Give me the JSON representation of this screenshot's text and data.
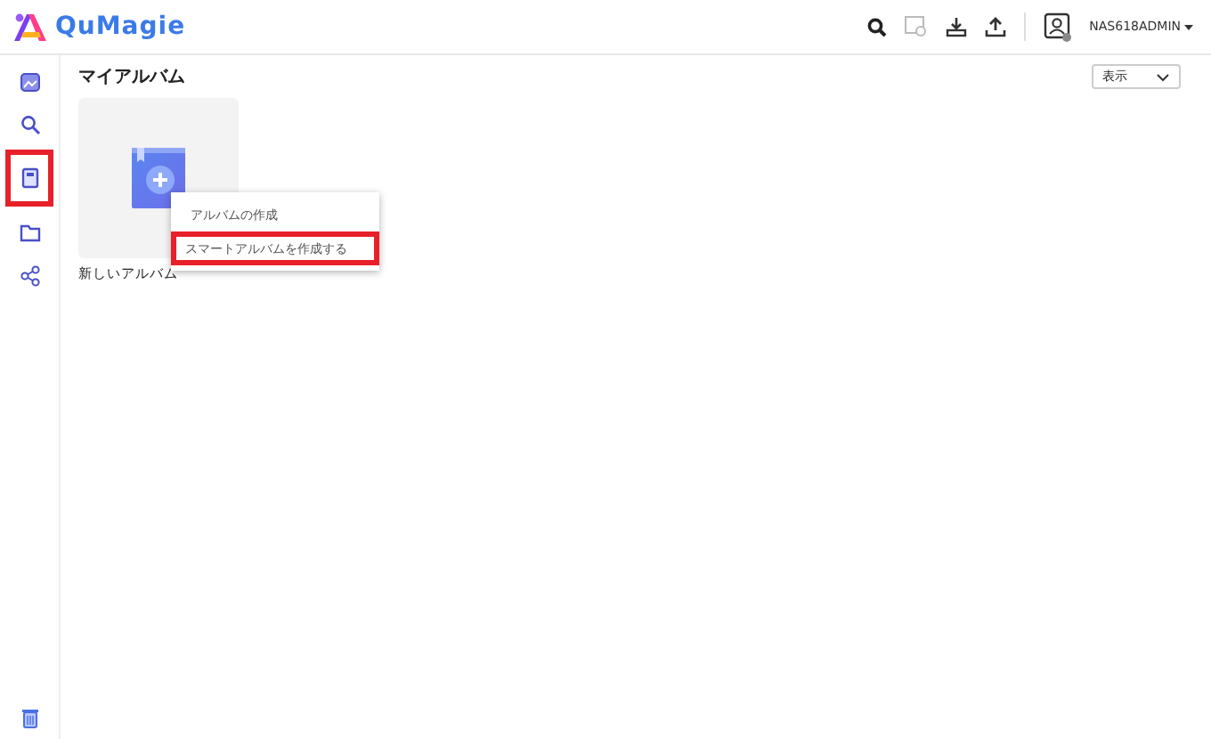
{
  "app": {
    "name": "QuMagie"
  },
  "header": {
    "user": "NAS618ADMIN"
  },
  "sidebar": {
    "items": [
      {
        "kind": "photos",
        "highlighted": false
      },
      {
        "kind": "search",
        "highlighted": false
      },
      {
        "kind": "album",
        "highlighted": true
      },
      {
        "kind": "folder",
        "highlighted": false
      },
      {
        "kind": "share",
        "highlighted": false
      }
    ]
  },
  "page": {
    "title": "マイアルバム",
    "view_select": "表示"
  },
  "albums": [
    {
      "label": "新しいアルバム",
      "kind": "new"
    }
  ],
  "context_menu": {
    "items": [
      {
        "label": "アルバムの作成",
        "highlighted": false
      },
      {
        "label": "スマートアルバムを作成する",
        "highlighted": true
      }
    ]
  }
}
